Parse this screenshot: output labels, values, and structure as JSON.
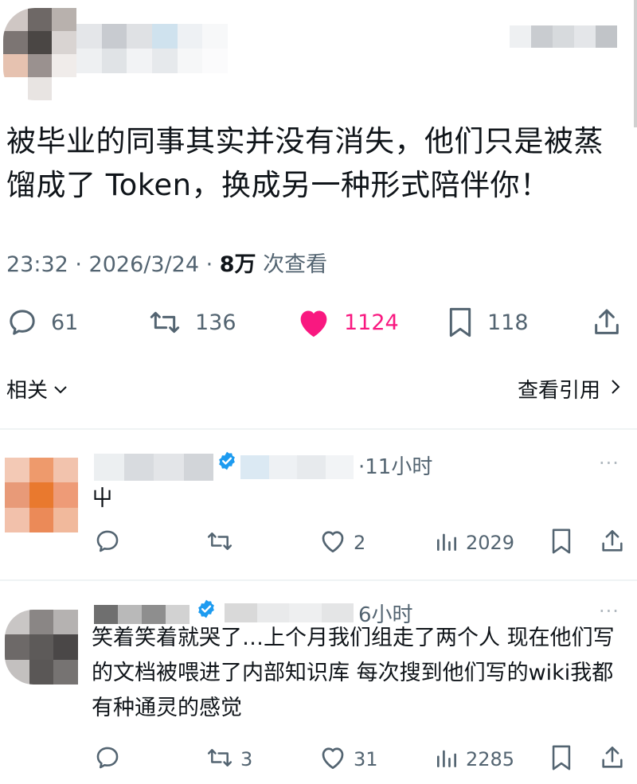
{
  "tweet": {
    "text": "被毕业的同事其实并没有消失，他们只是被蒸馏成了 Token，换成另一种形式陪伴你！",
    "time": "23:32 · 2026/3/24 · ",
    "views_value": "8万",
    "views_label": " 次查看",
    "stats": {
      "replies": "61",
      "retweets": "136",
      "likes": "1124",
      "bookmarks": "118"
    },
    "like_color": "#f91880"
  },
  "related": {
    "label": "相关",
    "view_quotes": "查看引用"
  },
  "replies": [
    {
      "time": "·11小时",
      "text": "屮",
      "stats": {
        "replies": "",
        "retweets": "",
        "likes": "2",
        "views": "2029"
      }
    },
    {
      "time": "6小时",
      "text": "笑着笑着就哭了…上个月我们组走了两个人 现在他们写的文档被喂进了内部知识库 每次搜到他们写的wiki我都有种通灵的感觉",
      "stats": {
        "replies": "",
        "retweets": "3",
        "likes": "31",
        "views": "2285"
      }
    }
  ],
  "icons": {
    "reply": "reply-icon",
    "retweet": "retweet-icon",
    "like": "heart-icon",
    "bookmark": "bookmark-icon",
    "share": "share-icon",
    "views": "views-icon",
    "verified": "verified-badge-icon"
  },
  "colors": {
    "text": "#0f1419",
    "secondary": "#536471",
    "verified": "#1d9bf0",
    "like": "#f91880"
  }
}
